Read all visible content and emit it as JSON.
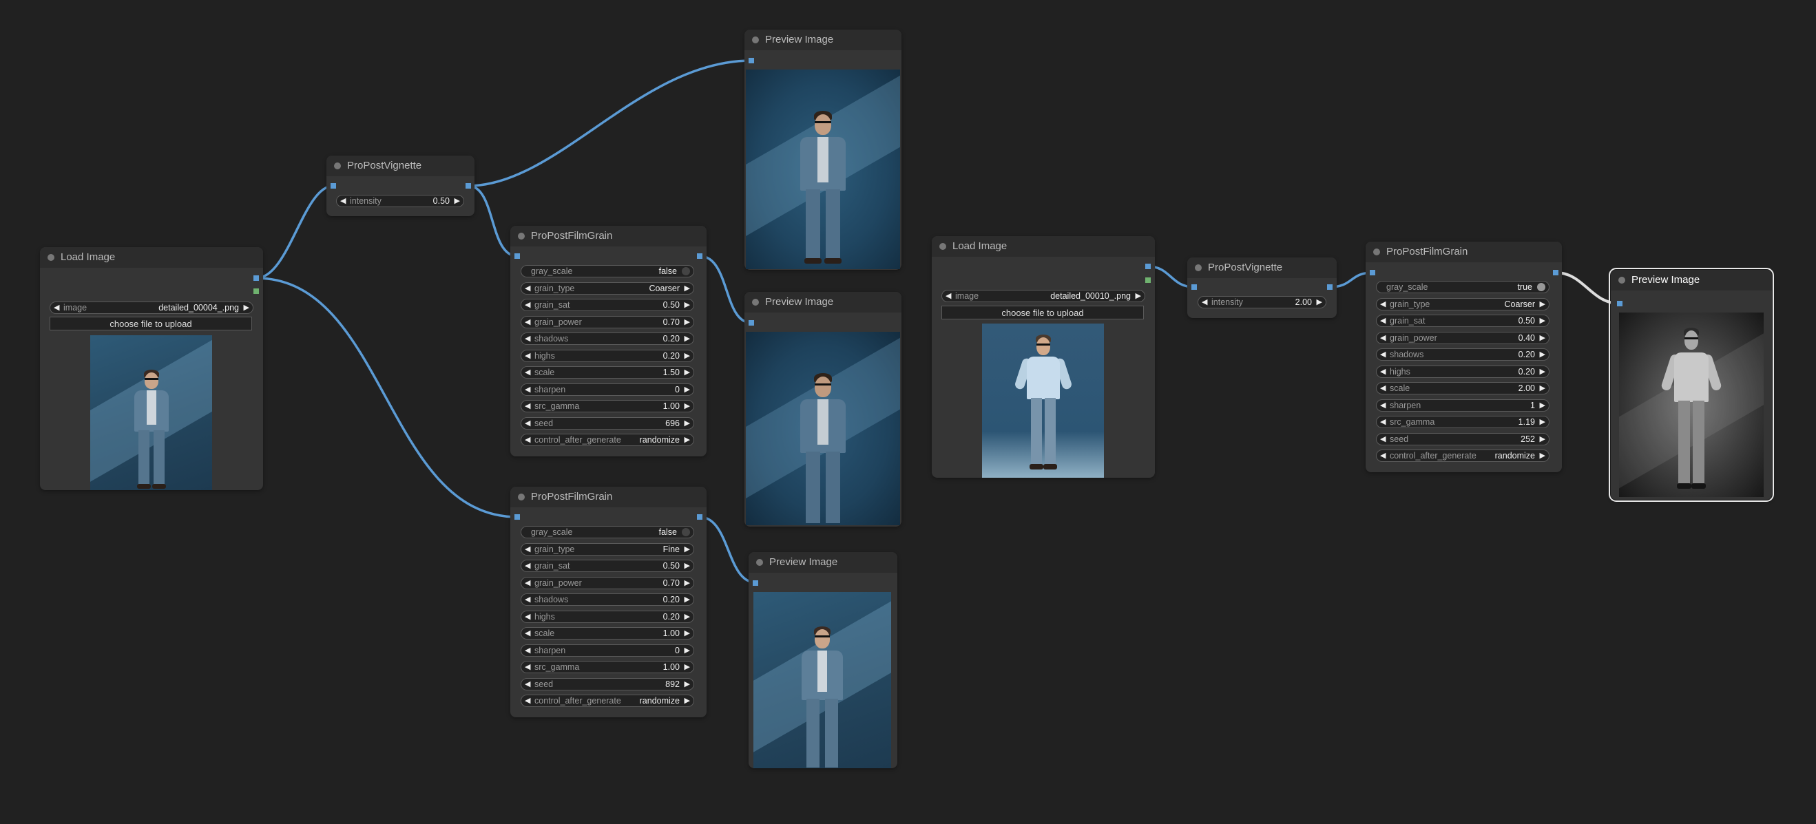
{
  "colors": {
    "canvas": "#212121",
    "node": "#353535",
    "title_bar": "#2c2c2c",
    "wire": "#5b9bd5",
    "image_slot": "#5b9bd5",
    "mask_slot": "#6fb26f"
  },
  "nodes": {
    "load1": {
      "title": "Load Image",
      "image_label": "image",
      "image_value": "detailed_00004_.png",
      "upload_label": "choose file to upload"
    },
    "vig1": {
      "title": "ProPostVignette",
      "intensity_label": "intensity",
      "intensity_value": "0.50"
    },
    "prev1": {
      "title": "Preview Image"
    },
    "grain1": {
      "title": "ProPostFilmGrain",
      "gray_scale_label": "gray_scale",
      "gray_scale_value": "false",
      "params": [
        {
          "label": "grain_type",
          "value": "Coarser"
        },
        {
          "label": "grain_sat",
          "value": "0.50"
        },
        {
          "label": "grain_power",
          "value": "0.70"
        },
        {
          "label": "shadows",
          "value": "0.20"
        },
        {
          "label": "highs",
          "value": "0.20"
        },
        {
          "label": "scale",
          "value": "1.50"
        },
        {
          "label": "sharpen",
          "value": "0"
        },
        {
          "label": "src_gamma",
          "value": "1.00"
        },
        {
          "label": "seed",
          "value": "696"
        },
        {
          "label": "control_after_generate",
          "value": "randomize"
        }
      ]
    },
    "prev2": {
      "title": "Preview Image"
    },
    "grain2": {
      "title": "ProPostFilmGrain",
      "gray_scale_label": "gray_scale",
      "gray_scale_value": "false",
      "params": [
        {
          "label": "grain_type",
          "value": "Fine"
        },
        {
          "label": "grain_sat",
          "value": "0.50"
        },
        {
          "label": "grain_power",
          "value": "0.70"
        },
        {
          "label": "shadows",
          "value": "0.20"
        },
        {
          "label": "highs",
          "value": "0.20"
        },
        {
          "label": "scale",
          "value": "1.00"
        },
        {
          "label": "sharpen",
          "value": "0"
        },
        {
          "label": "src_gamma",
          "value": "1.00"
        },
        {
          "label": "seed",
          "value": "892"
        },
        {
          "label": "control_after_generate",
          "value": "randomize"
        }
      ]
    },
    "prev3": {
      "title": "Preview Image"
    },
    "load2": {
      "title": "Load Image",
      "image_label": "image",
      "image_value": "detailed_00010_.png",
      "upload_label": "choose file to upload"
    },
    "vig2": {
      "title": "ProPostVignette",
      "intensity_label": "intensity",
      "intensity_value": "2.00"
    },
    "grain3": {
      "title": "ProPostFilmGrain",
      "gray_scale_label": "gray_scale",
      "gray_scale_value": "true",
      "params": [
        {
          "label": "grain_type",
          "value": "Coarser"
        },
        {
          "label": "grain_sat",
          "value": "0.50"
        },
        {
          "label": "grain_power",
          "value": "0.40"
        },
        {
          "label": "shadows",
          "value": "0.20"
        },
        {
          "label": "highs",
          "value": "0.20"
        },
        {
          "label": "scale",
          "value": "2.00"
        },
        {
          "label": "sharpen",
          "value": "1"
        },
        {
          "label": "src_gamma",
          "value": "1.19"
        },
        {
          "label": "seed",
          "value": "252"
        },
        {
          "label": "control_after_generate",
          "value": "randomize"
        }
      ]
    },
    "prev4": {
      "title": "Preview Image"
    }
  }
}
